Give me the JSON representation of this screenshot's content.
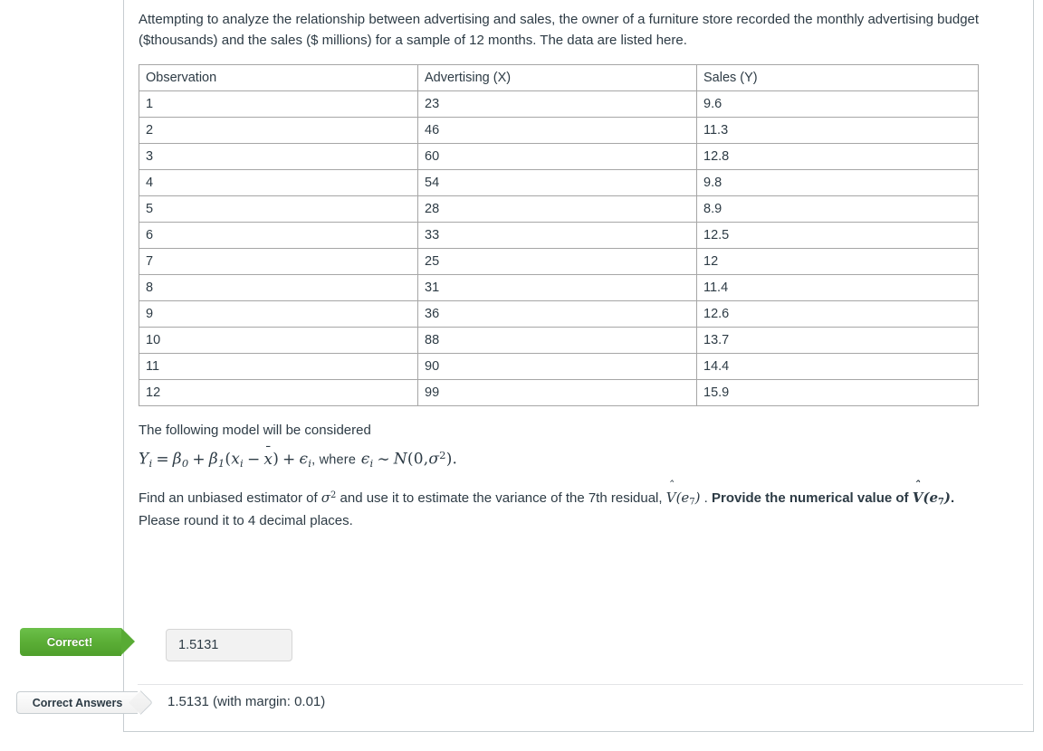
{
  "question": {
    "intro": "Attempting to analyze the relationship between advertising and sales, the owner of a furniture store recorded the monthly advertising budget ($thousands) and the sales ($ millions) for a sample of 12 months. The data are listed here.",
    "model_lead": "The following model will be considered",
    "formula_plain": "Y_i = β₀ + β₁(x_i − x̄) + ε_i, where ε_i ~ N(0, σ²).",
    "formula_parts": {
      "lhs_var": "Y",
      "lhs_sub": "i",
      "equals": "=",
      "beta0": "β",
      "beta0_sub": "0",
      "plus1": "+",
      "beta1": "β",
      "beta1_sub": "1",
      "paren_open": "(",
      "x_var": "x",
      "x_sub": "i",
      "minus": "−",
      "xbar": "x",
      "paren_close": ")",
      "plus2": "+",
      "eps": "ϵ",
      "eps_sub": "i",
      "where": ", where",
      "eps2": "ϵ",
      "eps2_sub": "i",
      "tilde": "∼",
      "normal": "N",
      "normal_args_open": "(0,",
      "sigma": "σ",
      "sigma_sup": "2",
      "normal_args_close": ").",
      "hat_glyph": "ˆ",
      "bar_glyph": "¯"
    },
    "prompt_part1": "Find an unbiased estimator of ",
    "prompt_sigma": "σ",
    "prompt_sigma_sup": "2",
    "prompt_part2": " and use it to estimate the variance of the 7th residual, ",
    "prompt_vhat_V": "V",
    "prompt_vhat_args": "(e",
    "prompt_vhat_sub": "7",
    "prompt_vhat_close": ")",
    "prompt_part3": " . ",
    "prompt_bold_lead": "Provide the numerical value of ",
    "prompt_bold_tail": ".",
    "prompt_part4": "Please round it to 4 decimal places."
  },
  "table": {
    "headers": [
      "Observation",
      "Advertising (X)",
      "Sales (Y)"
    ],
    "rows": [
      [
        "1",
        "23",
        "9.6"
      ],
      [
        "2",
        "46",
        "11.3"
      ],
      [
        "3",
        "60",
        "12.8"
      ],
      [
        "4",
        "54",
        "9.8"
      ],
      [
        "5",
        "28",
        "8.9"
      ],
      [
        "6",
        "33",
        "12.5"
      ],
      [
        "7",
        "25",
        "12"
      ],
      [
        "8",
        "31",
        "11.4"
      ],
      [
        "9",
        "36",
        "12.6"
      ],
      [
        "10",
        "88",
        "13.7"
      ],
      [
        "11",
        "90",
        "14.4"
      ],
      [
        "12",
        "99",
        "15.9"
      ]
    ]
  },
  "result": {
    "status_label": "Correct!",
    "status_color": "#5aad35",
    "submitted_answer": "1.5131"
  },
  "correct_answers": {
    "label": "Correct Answers",
    "value": "1.5131 (with margin: 0.01)"
  }
}
